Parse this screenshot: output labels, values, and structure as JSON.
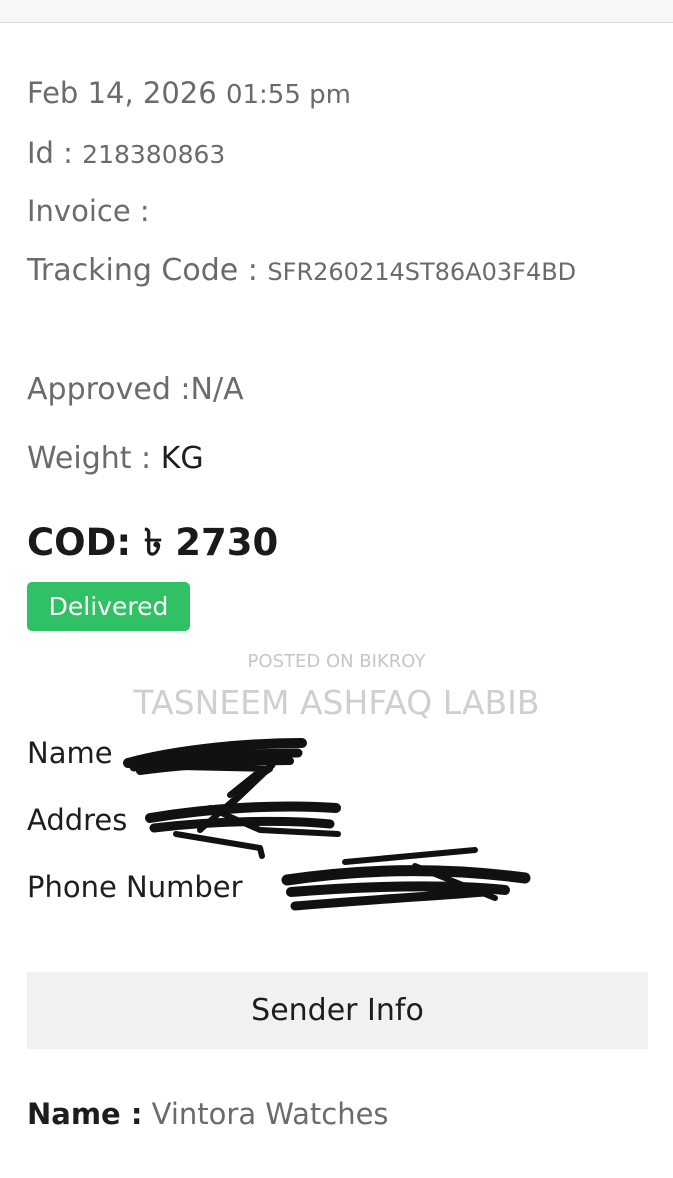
{
  "order": {
    "date": "Feb 14, 2026",
    "time": "01:55 pm",
    "id_label": "Id :",
    "id_value": "218380863",
    "invoice_label": "Invoice :",
    "tracking_label": "Tracking Code :",
    "tracking_value": "SFR260214ST86A03F4BD",
    "approved_text": "Approved :N/A",
    "weight_label": "Weight :",
    "weight_value": "KG",
    "cod_text": "COD: ৳ 2730",
    "status": "Delivered",
    "status_color": "#2fc163"
  },
  "watermark": {
    "line1": "POSTED ON BIKROY",
    "line2": "TASNEEM ASHFAQ LABIB"
  },
  "receiver": {
    "name_label": "Name",
    "address_label": "Addres",
    "phone_label": "Phone Number"
  },
  "sender": {
    "section_title": "Sender Info",
    "name_label": "Name :",
    "name_value": "Vintora Watches"
  }
}
